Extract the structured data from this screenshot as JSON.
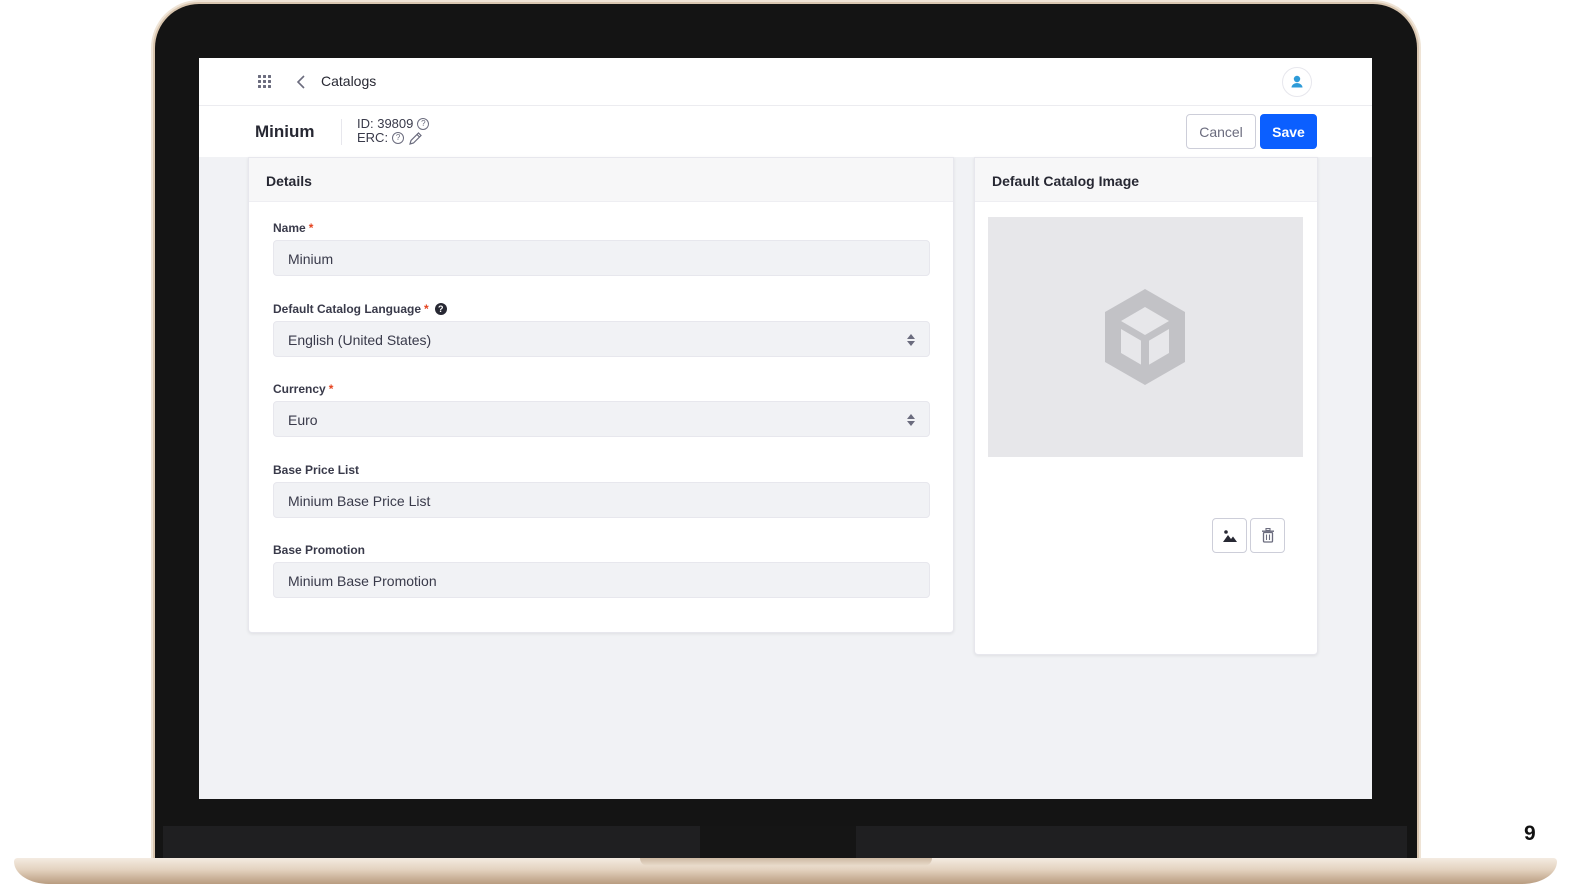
{
  "page_number": "9",
  "nav": {
    "title": "Catalogs"
  },
  "header": {
    "entity_title": "Minium",
    "id_label": "ID: 39809",
    "erc_label": "ERC:",
    "cancel_label": "Cancel",
    "save_label": "Save"
  },
  "details": {
    "title": "Details",
    "fields": [
      {
        "label": "Name",
        "required": "*",
        "value": "Minium"
      },
      {
        "label": "Default Catalog Language",
        "required": "*",
        "value": "English (United States)"
      },
      {
        "label": "Currency",
        "required": "*",
        "value": "Euro"
      },
      {
        "label": "Base Price List",
        "value": "Minium Base Price List"
      },
      {
        "label": "Base Promotion",
        "value": "Minium Base Promotion"
      }
    ]
  },
  "image_panel": {
    "title": "Default Catalog Image"
  },
  "icons": {
    "apps": "grid-apps-icon",
    "back": "chevron-left-icon",
    "avatar": "user-icon",
    "help": "question-circle-icon",
    "edit": "pencil-icon",
    "select": "caret-double-icon",
    "upload": "image-icon",
    "delete": "trash-icon",
    "placeholder": "box-icon"
  },
  "colors": {
    "primary": "#0b5fff",
    "required": "#e5431f",
    "background": "#f1f2f5"
  }
}
